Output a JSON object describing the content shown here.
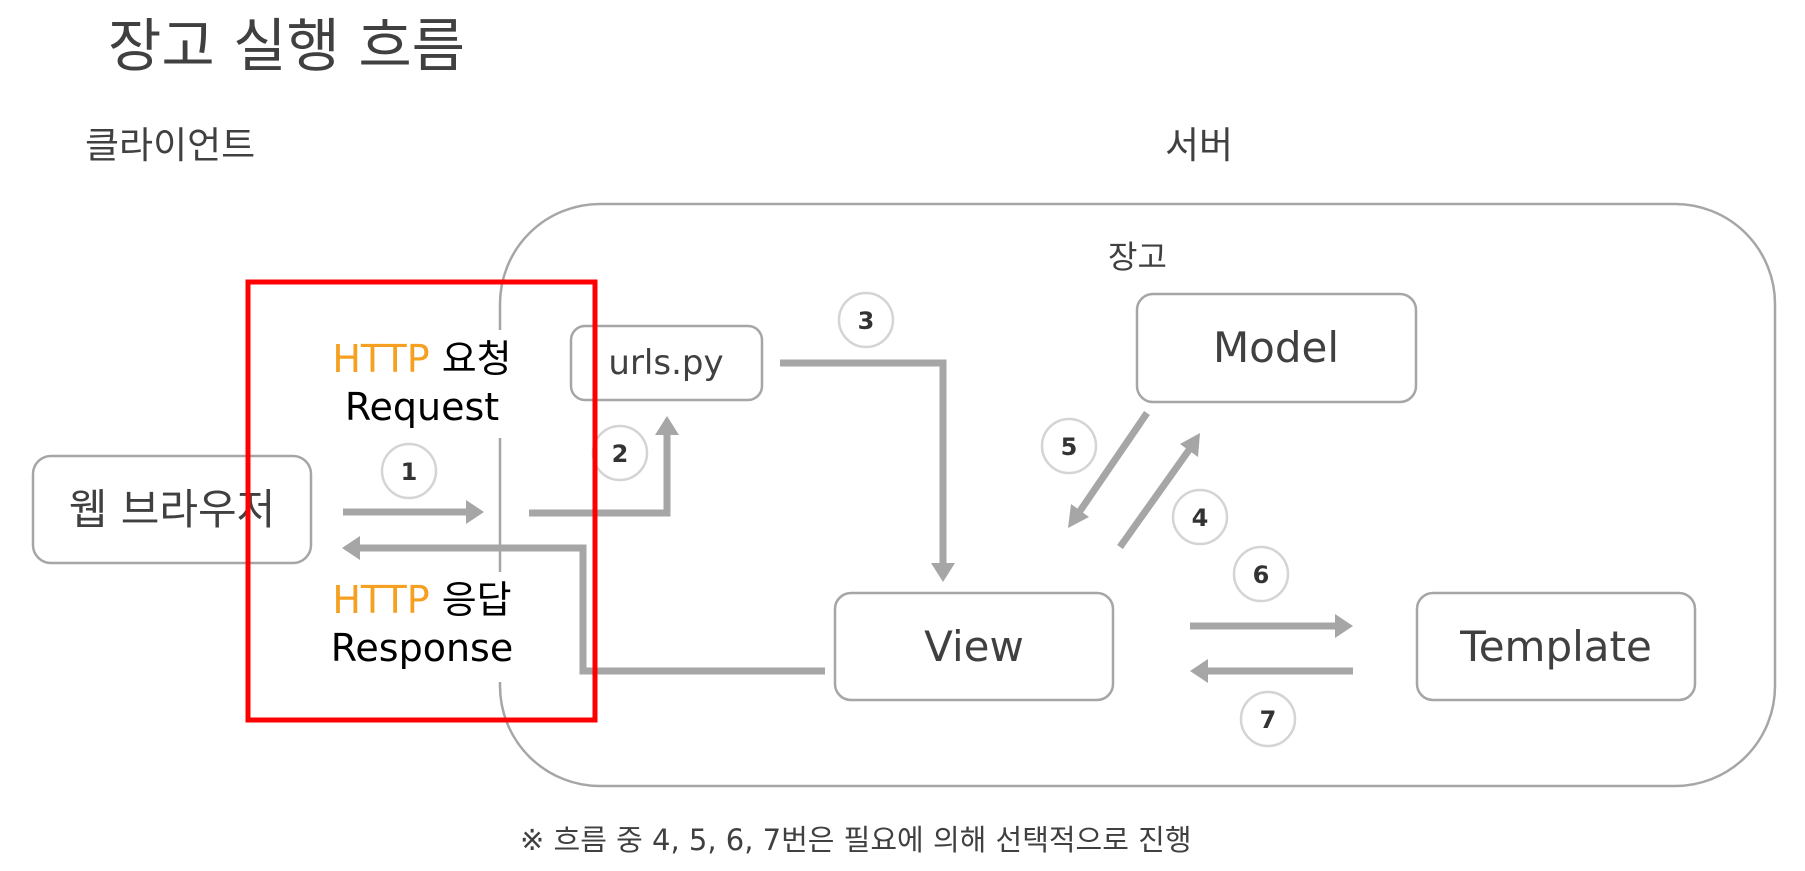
{
  "title": "장고 실행 흐름",
  "sections": {
    "client": "클라이언트",
    "server": "서버"
  },
  "framework_label": "장고",
  "nodes": {
    "browser": "웹 브라우저",
    "urls": "urls.py",
    "model": "Model",
    "view": "View",
    "template": "Template"
  },
  "http": {
    "request": {
      "protocol": "HTTP",
      "korean": "요청",
      "english": "Request"
    },
    "response": {
      "protocol": "HTTP",
      "korean": "응답",
      "english": "Response"
    }
  },
  "steps": [
    "1",
    "2",
    "3",
    "4",
    "5",
    "6",
    "7"
  ],
  "note": "※ 흐름 중 4, 5, 6, 7번은 필요에 의해 선택적으로 진행",
  "colors": {
    "accent": "#f5a020",
    "highlight": "#ff0000",
    "line": "#a6a6a6",
    "text": "#404040"
  }
}
